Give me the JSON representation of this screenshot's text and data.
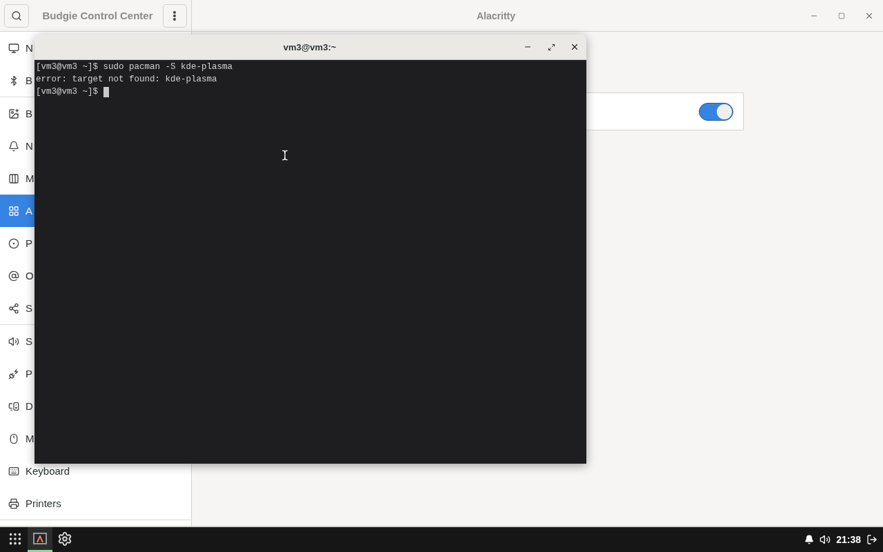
{
  "control_center": {
    "title": "Budgie Control Center",
    "panel_title": "Alacritty",
    "sidebar_groups": [
      {
        "items": [
          {
            "label": "N",
            "selected": false
          },
          {
            "label": "B",
            "selected": false
          }
        ]
      },
      {
        "items": [
          {
            "label": "B",
            "selected": false
          },
          {
            "label": "N",
            "selected": false
          },
          {
            "label": "M",
            "selected": false
          },
          {
            "label": "A",
            "selected": true
          },
          {
            "label": "P",
            "selected": false
          },
          {
            "label": "O",
            "selected": false
          },
          {
            "label": "S",
            "selected": false
          }
        ]
      },
      {
        "items": [
          {
            "label": "S",
            "selected": false
          },
          {
            "label": "P",
            "selected": false
          },
          {
            "label": "D",
            "selected": false
          },
          {
            "label": "M",
            "selected": false
          },
          {
            "label": "Keyboard",
            "selected": false
          },
          {
            "label": "Printers",
            "selected": false
          }
        ]
      }
    ],
    "setting_switch": {
      "on": true
    }
  },
  "terminal": {
    "title": "vm3@vm3:~",
    "lines": [
      "[vm3@vm3 ~]$ sudo pacman -S kde-plasma",
      "error: target not found: kde-plasma",
      "[vm3@vm3 ~]$"
    ],
    "cursor_visible": true
  },
  "taskbar": {
    "apps": [
      {
        "kind": "terminal",
        "active": true
      },
      {
        "kind": "settings",
        "active": false
      }
    ],
    "clock": "21:38"
  }
}
